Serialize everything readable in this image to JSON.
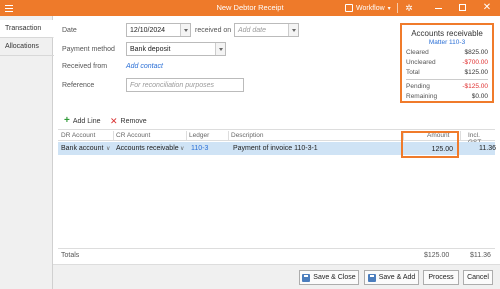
{
  "window": {
    "title": "New Debtor Receipt",
    "workflow_label": "Workflow"
  },
  "tabs": [
    {
      "label": "Transaction",
      "active": true
    },
    {
      "label": "Allocations",
      "active": false
    }
  ],
  "form": {
    "date_label": "Date",
    "date_value": "12/10/2024",
    "received_on_label": "received on",
    "received_on_placeholder": "Add date",
    "payment_method_label": "Payment method",
    "payment_method_value": "Bank deposit",
    "received_from_label": "Received from",
    "add_contact_link": "Add contact",
    "reference_label": "Reference",
    "reference_placeholder": "For reconciliation purposes"
  },
  "accounts_receivable": {
    "title": "Accounts receivable",
    "matter": "Matter 110-3",
    "rows": [
      {
        "label": "Cleared",
        "value": "$825.00",
        "negative": false
      },
      {
        "label": "Uncleared",
        "value": "-$700.00",
        "negative": true
      },
      {
        "label": "Total",
        "value": "$125.00",
        "negative": false
      },
      {
        "label": "Pending",
        "value": "-$125.00",
        "negative": true
      },
      {
        "label": "Remaining",
        "value": "$0.00",
        "negative": false
      }
    ]
  },
  "toolbar": {
    "add_line": "Add Line",
    "remove": "Remove"
  },
  "grid": {
    "columns": [
      "DR Account",
      "CR Account",
      "Ledger",
      "Description",
      "Amount",
      "Incl. GST"
    ],
    "rows": [
      {
        "dr_account": "Bank account",
        "cr_account": "Accounts receivable",
        "ledger": "110-3",
        "description": "Payment of invoice 110-3-1",
        "amount": "125.00",
        "incl_gst": "11.36"
      }
    ]
  },
  "totals": {
    "label": "Totals",
    "amount": "$125.00",
    "gst": "$11.36"
  },
  "footer": {
    "save_close": "Save & Close",
    "save_add": "Save & Add",
    "process": "Process",
    "cancel": "Cancel"
  },
  "colors": {
    "accent": "#ee7a2a",
    "highlight_border": "#f07b2b",
    "link": "#2a6fd6",
    "negative": "#e03030",
    "selected_row": "#cfe3f5"
  }
}
